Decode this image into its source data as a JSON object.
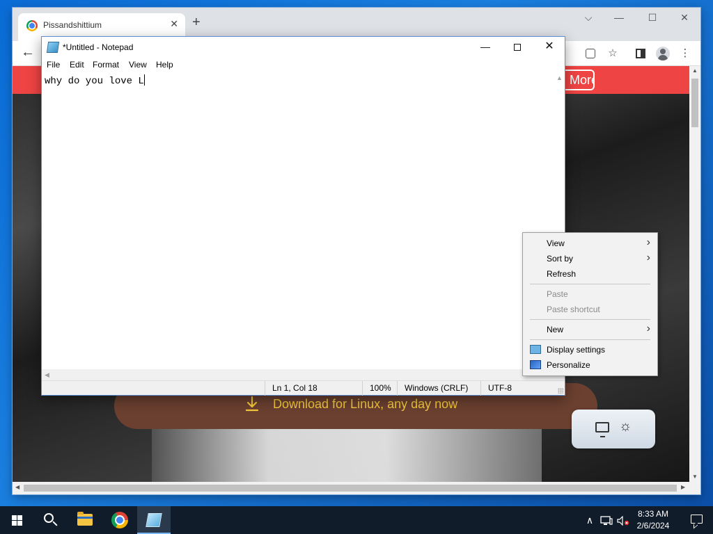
{
  "browser": {
    "tab_title": "Pissandshittium",
    "tab_close": "✕",
    "new_tab": "+",
    "win_controls": {
      "tabsearch": "⌵",
      "minimize": "—",
      "maximize": "☐",
      "close": "✕"
    },
    "back": "←",
    "star": "☆",
    "menu": "⋮"
  },
  "website": {
    "banner_button": "More",
    "download_label": "Download for Linux, any day now",
    "accent_color": "#ef4444",
    "download_color": "#f6c93a"
  },
  "notepad": {
    "title": "*Untitled - Notepad",
    "menu": [
      "File",
      "Edit",
      "Format",
      "View",
      "Help"
    ],
    "text": "why do you love L",
    "status": {
      "position": "Ln 1, Col 18",
      "zoom": "100%",
      "line_ending": "Windows (CRLF)",
      "encoding": "UTF-8"
    }
  },
  "context_menu": {
    "view": "View",
    "sort_by": "Sort by",
    "refresh": "Refresh",
    "paste": "Paste",
    "paste_shortcut": "Paste shortcut",
    "new": "New",
    "display_settings": "Display settings",
    "personalize": "Personalize"
  },
  "taskbar": {
    "time": "8:33 AM",
    "date": "2/6/2024",
    "tray_chevron": "∧"
  }
}
